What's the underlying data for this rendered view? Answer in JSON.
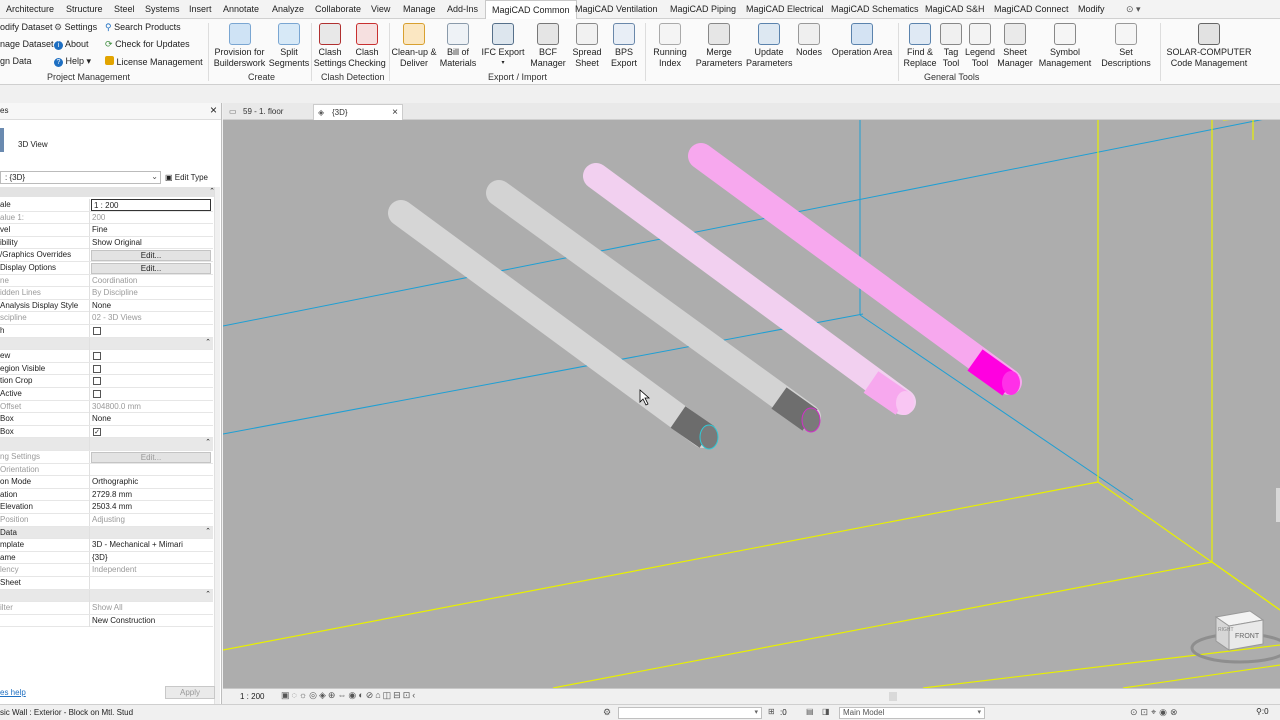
{
  "tabs": {
    "items": [
      "Architecture",
      "Structure",
      "Steel",
      "Systems",
      "Insert",
      "Annotate",
      "Analyze",
      "Collaborate",
      "View",
      "Manage",
      "Add-Ins",
      "MagiCAD Common",
      "MagiCAD Ventilation",
      "MagiCAD Piping",
      "MagiCAD Electrical",
      "MagiCAD Schematics",
      "MagiCAD S&H",
      "MagiCAD Connect",
      "Modify"
    ]
  },
  "ribbon": {
    "small": [
      "odify Dataset",
      "nage Dataset",
      "gn Data",
      "Settings",
      "About",
      "Help",
      "Search Products",
      "Check for Updates",
      "License Management"
    ],
    "buttons": [
      "Provision for\nBuilderswork",
      "Split\nSegments",
      "Clash\nSettings",
      "Clash\nChecking",
      "Clean-up &\nDeliver",
      "Bill of\nMaterials",
      "IFC Export",
      "BCF\nManager",
      "Spread\nSheet",
      "BPS\nExport",
      "Running\nIndex",
      "Merge\nParameters",
      "Update\nParameters",
      "Nodes",
      "Operation Area",
      "Find &\nReplace",
      "Tag\nTool",
      "Legend\nTool",
      "Sheet\nManager",
      "Symbol\nManagement",
      "Set\nDescriptions",
      "SOLAR-COMPUTER\nCode Management"
    ],
    "groups": [
      "Project Management",
      "Create",
      "Clash Detection",
      "Export / Import",
      "General Tools"
    ]
  },
  "properties": {
    "close": "×",
    "view_type": "3D View",
    "selector": ": {3D}",
    "edit_type": "Edit Type",
    "rows": [
      {
        "k": "ale",
        "v": "1 : 200"
      },
      {
        "k": "alue   1:",
        "v": "200"
      },
      {
        "k": "vel",
        "v": "Fine"
      },
      {
        "k": "ibility",
        "v": "Show Original"
      },
      {
        "k": "/Graphics Overrides",
        "v": "Edit..."
      },
      {
        "k": " Display Options",
        "v": "Edit..."
      },
      {
        "k": "ne",
        "v": "Coordination"
      },
      {
        "k": "idden Lines",
        "v": "By Discipline"
      },
      {
        "k": " Analysis Display Style",
        "v": "None"
      },
      {
        "k": "scipline",
        "v": "02 - 3D Views"
      },
      {
        "k": "h",
        "v": ""
      },
      {
        "k": "",
        "v": ""
      },
      {
        "k": "ew",
        "v": ""
      },
      {
        "k": "egion Visible",
        "v": ""
      },
      {
        "k": "tion Crop",
        "v": ""
      },
      {
        "k": " Active",
        "v": ""
      },
      {
        "k": " Offset",
        "v": "304800.0 mm"
      },
      {
        "k": "Box",
        "v": "None"
      },
      {
        "k": "Box",
        "v": "✓"
      },
      {
        "k": "",
        "v": ""
      },
      {
        "k": "ng Settings",
        "v": "Edit..."
      },
      {
        "k": " Orientation",
        "v": ""
      },
      {
        "k": "on Mode",
        "v": "Orthographic"
      },
      {
        "k": "ation",
        "v": "2729.8 mm"
      },
      {
        "k": "Elevation",
        "v": "2503.4 mm"
      },
      {
        "k": " Position",
        "v": "Adjusting"
      },
      {
        "k": "Data",
        "v": ""
      },
      {
        "k": "mplate",
        "v": "3D - Mechanical + Mimari"
      },
      {
        "k": "ame",
        "v": "{3D}"
      },
      {
        "k": "lency",
        "v": "Independent"
      },
      {
        "k": " Sheet",
        "v": ""
      },
      {
        "k": "",
        "v": ""
      },
      {
        "k": "ilter",
        "v": "Show All"
      },
      {
        "k": "",
        "v": "New Construction"
      }
    ],
    "help": "es help",
    "apply": "Apply"
  },
  "viewtabs": [
    {
      "label": "59 - 1. floor"
    },
    {
      "label": "{3D}"
    }
  ],
  "viewbar": {
    "scale": "1 : 200"
  },
  "status": {
    "left": "sic Wall : Exterior - Block on Mtl. Stud",
    "zero1": ":0",
    "model": "Main Model",
    "zero2": ":0"
  },
  "viewcube": {
    "face": "FRONT",
    "side": "RIGHT"
  },
  "colors": {
    "viewport_bg": "#adadad",
    "pipe_grey_light": "#d6d6d6",
    "pipe_pink_light": "#f2d0f0",
    "pipe_pink": "#f7a8ee",
    "pipe_magenta": "#ff00e0",
    "grid_cyan": "#1e9fd4",
    "wall_yellow": "#e8f000"
  }
}
